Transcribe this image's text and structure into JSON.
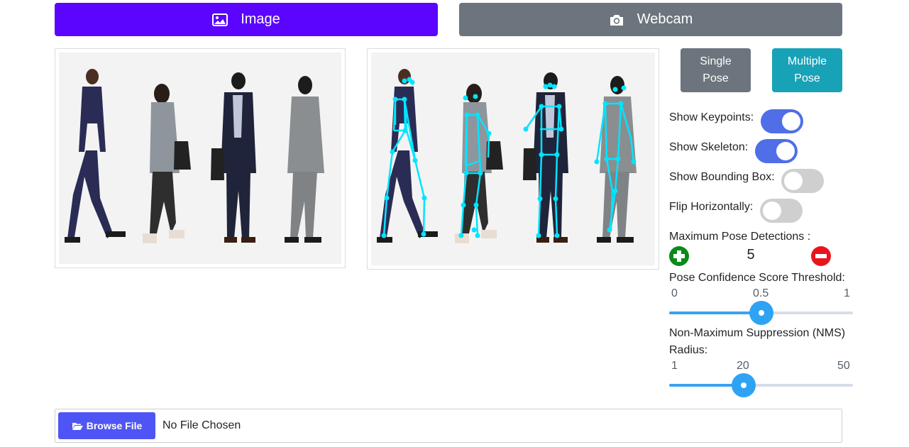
{
  "tabs": {
    "image_label": "Image",
    "webcam_label": "Webcam"
  },
  "mode": {
    "single_label": "Single Pose",
    "multiple_label": "Multiple Pose",
    "selected": "Multiple Pose"
  },
  "options": {
    "show_keypoints": {
      "label": "Show Keypoints:",
      "on": true
    },
    "show_skeleton": {
      "label": "Show Skeleton:",
      "on": true
    },
    "show_bounding_box": {
      "label": "Show Bounding Box:",
      "on": false
    },
    "flip_horizontally": {
      "label": "Flip Horizontally:",
      "on": false
    }
  },
  "max_pose": {
    "label": "Maximum Pose Detections :",
    "value": "5"
  },
  "confidence_slider": {
    "label": "Pose Confidence Score Threshold:",
    "min_label": "0",
    "mid_label": "0.5",
    "max_label": "1",
    "value": 0.5
  },
  "nms_slider": {
    "label_line1": "Non-Maximum Suppression (NMS)",
    "label_line2": "Radius:",
    "min_label": "1",
    "mid_label": "20",
    "max_label": "50",
    "value": 20
  },
  "file": {
    "browse_label": "Browse File",
    "status": "No File Chosen"
  },
  "colors": {
    "image_tab": "#5b05ff",
    "webcam_tab": "#6c757d",
    "toggle_on": "#4f6ee8",
    "toggle_off": "#cfcfcf",
    "keypoint": "#00e5ff",
    "slider": "#2fa3f3",
    "plus": "#0a8a19",
    "minus": "#e8151b",
    "browse": "#4f55f5"
  },
  "icons": {
    "image_tab": "image-icon",
    "webcam_tab": "camera-icon",
    "browse": "folder-open-icon",
    "increment": "plus-circle-icon",
    "decrement": "minus-circle-icon"
  }
}
